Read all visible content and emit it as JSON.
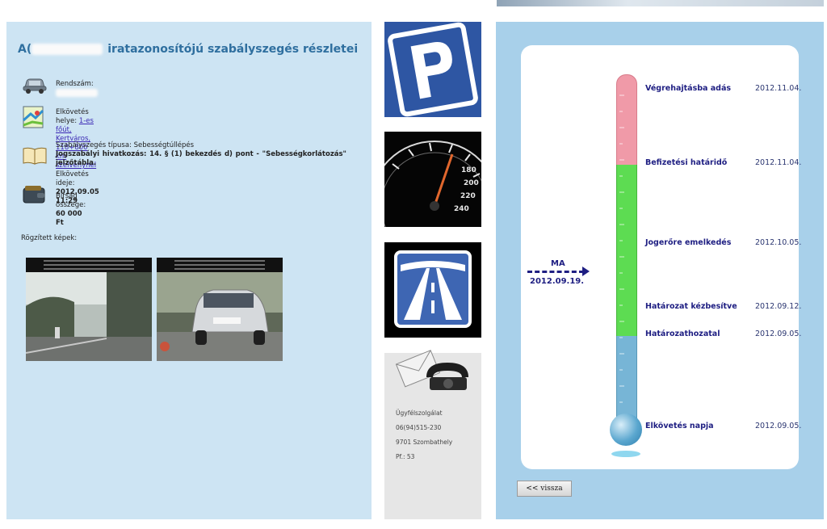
{
  "left": {
    "title_prefix": "A(",
    "title_suffix": "iratazonosítójú szabályszegés részletei",
    "plate_label": "Rendszám:",
    "place_label": "Elkövetés helye:",
    "place_value": "1-es főút, Kertváros, 118+800 km szelvénynél",
    "time_label": "Elkövetés ideje:",
    "time_value": "2012.09.05 11:29",
    "type_label": "Szabályszegés típusa:",
    "type_value": "Sebességtúllépés",
    "law_text": "Jogszabályi hivatkozás: 14. § (1) bekezdés d) pont - \"Sebességkorlátozás\" jelzőtábla.",
    "fine_label": "Bírság összege:",
    "fine_value": "60 000 Ft",
    "photos_label": "Rögzített képek:"
  },
  "contact": {
    "title": "Ügyfélszolgálat",
    "phone": "06(94)515-230",
    "city": "9701 Szombathely",
    "pobox": "Pf.: 53"
  },
  "timeline": {
    "events": [
      {
        "label": "Végrehajtásba adás",
        "date": "2012.11.04."
      },
      {
        "label": "Befizetési határidő",
        "date": "2012.11.04."
      },
      {
        "label": "Jogerőre emelkedés",
        "date": "2012.10.05."
      },
      {
        "label": "Határozat kézbesítve",
        "date": "2012.09.12."
      },
      {
        "label": "Határozathozatal",
        "date": "2012.09.05."
      },
      {
        "label": "Elkövetés napja",
        "date": "2012.09.05."
      }
    ],
    "today_label": "MA",
    "today_date": "2012.09.19."
  },
  "back_button": "<< vissza",
  "icons": {
    "car": "car-icon",
    "map": "map-icon",
    "book": "book-icon",
    "wallet": "wallet-icon",
    "parking": "parking-sign-icon",
    "speedometer": "speedometer-icon",
    "highway": "highway-sign-icon",
    "contact": "envelope-phone-icon"
  },
  "colors": {
    "left_bg": "#cde4f3",
    "right_bg": "#a8d0ea",
    "title": "#2f6f9f",
    "event_text": "#1e1e82",
    "thermo_red": "#f09aa8",
    "thermo_green": "#5ddc52",
    "thermo_blue": "#77b5d6"
  }
}
